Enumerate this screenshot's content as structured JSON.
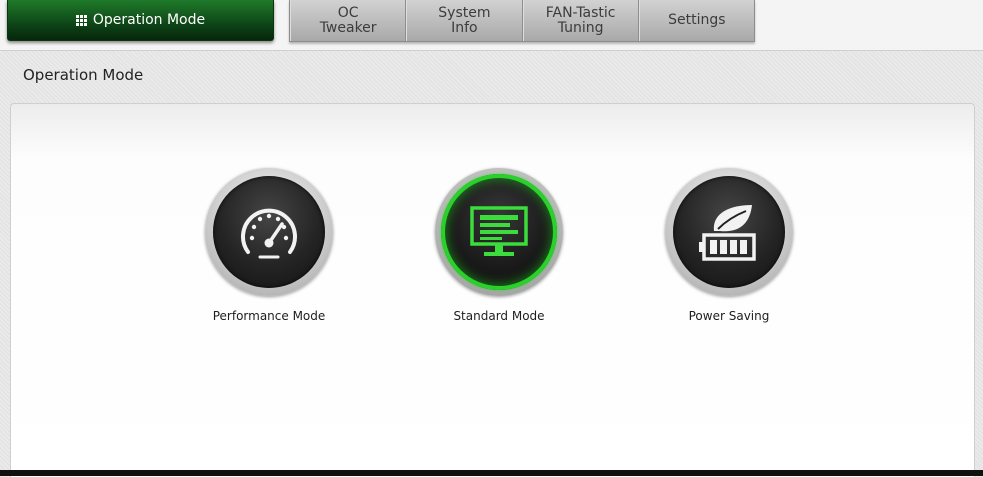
{
  "tabs": {
    "active": "Operation Mode",
    "others": [
      "OC Tweaker",
      "System Info",
      "FAN-Tastic Tuning",
      "Settings"
    ]
  },
  "section_title": "Operation Mode",
  "modes": [
    {
      "label": "Performance Mode",
      "icon": "speedometer-icon",
      "selected": false
    },
    {
      "label": "Standard Mode",
      "icon": "monitor-icon",
      "selected": true
    },
    {
      "label": "Power Saving",
      "icon": "leaf-battery-icon",
      "selected": false
    }
  ],
  "colors": {
    "accent": "#2bd12b",
    "active_tab": "#0b3d14"
  }
}
